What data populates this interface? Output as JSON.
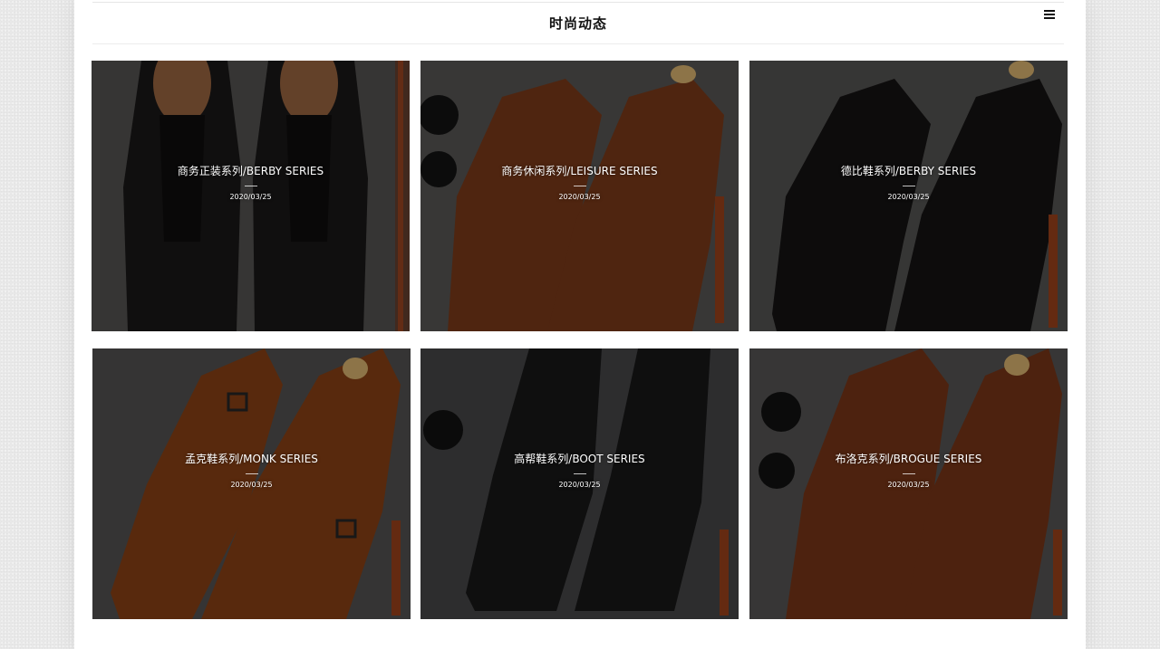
{
  "header": {
    "title": "时尚动态",
    "menu_icon": "hamburger-menu-icon"
  },
  "cards": [
    {
      "name": "商务正装系列/BERBY SERIES",
      "date": "2020/03/25",
      "shoe_color": "#171515"
    },
    {
      "name": "商务休闲系列/LEISURE SERIES",
      "date": "2020/03/25",
      "shoe_color": "#6e3417"
    },
    {
      "name": "德比鞋系列/BERBY SERIES",
      "date": "2020/03/25",
      "shoe_color": "#121111"
    },
    {
      "name": "孟克鞋系列/MONK SERIES",
      "date": "2020/03/25",
      "shoe_color": "#7a3a13"
    },
    {
      "name": "高帮鞋系列/BOOT SERIES",
      "date": "2020/03/25",
      "shoe_color": "#151516"
    },
    {
      "name": "布洛克系列/BROGUE SERIES",
      "date": "2020/03/25",
      "shoe_color": "#6b3016"
    }
  ],
  "colors": {
    "page_background": "#e9e9e9",
    "card_background": "#4a4a4a",
    "text": "#ffffff"
  }
}
